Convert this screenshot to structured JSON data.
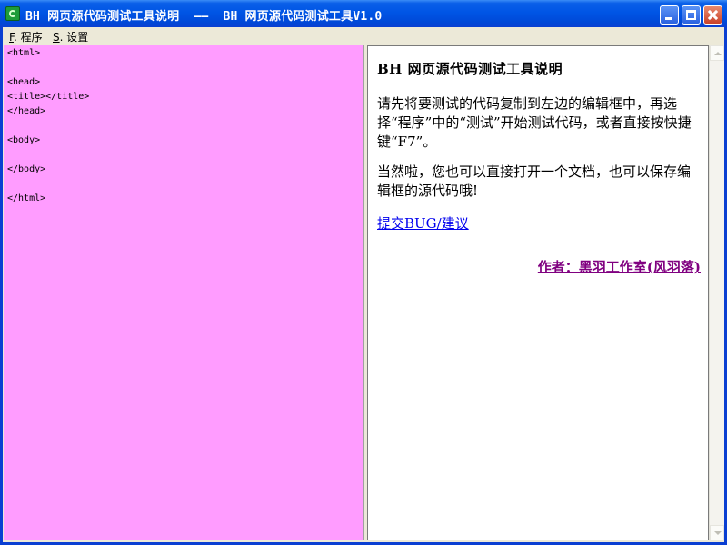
{
  "window": {
    "title": "BH 网页源代码测试工具说明  ——  BH 网页源代码测试工具V1.0",
    "icon": "app-icon",
    "controls": [
      "minimize-icon",
      "maximize-icon",
      "close-icon"
    ]
  },
  "menu": {
    "items": [
      {
        "key": "F",
        "label": ". 程序"
      },
      {
        "key": "S",
        "label": ". 设置"
      }
    ]
  },
  "editor": {
    "code": "<html>\n\n<head>\n<title></title>\n</head>\n\n<body>\n\n</body>\n\n</html>",
    "background": "#ff9cff"
  },
  "preview": {
    "title": "BH 网页源代码测试工具说明",
    "para1": "请先将要测试的代码复制到左边的编辑框中，再选择“程序”中的“测试”开始测试代码，或者直接按快捷键“F7”。",
    "para2": "当然啦，您也可以直接打开一个文档，也可以保存编辑框的源代码哦!",
    "link": "提交BUG/建议",
    "author": "作者：黑羽工作室(风羽落)"
  },
  "colors": {
    "titlebar": "#0055e5",
    "link": "#0000ee",
    "author": "#800080"
  }
}
